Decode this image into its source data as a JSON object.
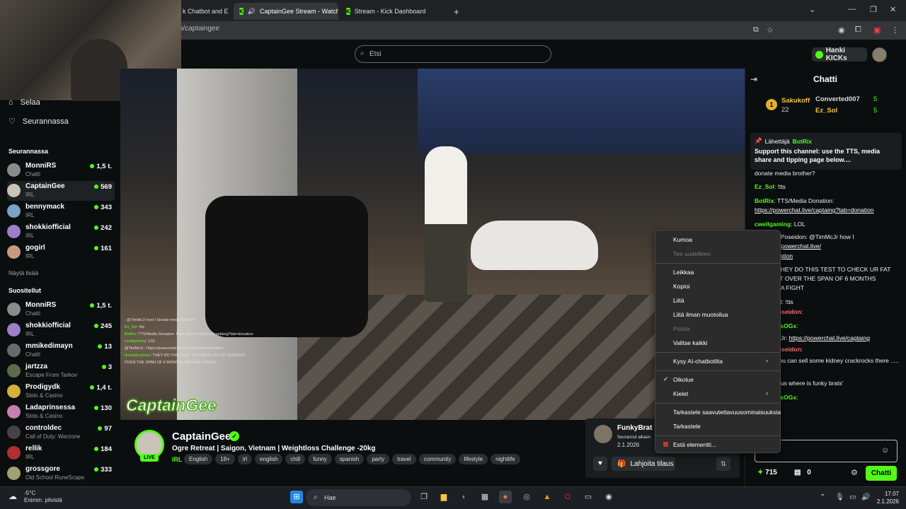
{
  "browser": {
    "tabs": [
      {
        "label": "k Chatbot and E",
        "active": false
      },
      {
        "label": "CaptainGee Stream - Watch",
        "active": true
      },
      {
        "label": "Stream - Kick Dashboard",
        "active": false
      }
    ],
    "new_tab": "+",
    "url": "m/captaingee"
  },
  "header": {
    "search_placeholder": "Etsi",
    "kicks_label": "Hanki KICKs"
  },
  "sidebar": {
    "browse_label": "Selaa",
    "following_nav_label": "Seurannassa",
    "following_heading": "Seurannassa",
    "following": [
      {
        "name": "MonniRS",
        "category": "Chatti",
        "viewers": "1,5 t.",
        "color": "#8b8b8b"
      },
      {
        "name": "CaptainGee",
        "category": "IRL",
        "viewers": "569",
        "color": "#c9c3b8"
      },
      {
        "name": "bennymack",
        "category": "IRL",
        "viewers": "343",
        "color": "#7aa2c7"
      },
      {
        "name": "shokkiofficial",
        "category": "IRL",
        "viewers": "242",
        "color": "#9b7fc7"
      },
      {
        "name": "gogirl",
        "category": "IRL",
        "viewers": "161",
        "color": "#c79a7f"
      }
    ],
    "show_more": "Näytä lisää",
    "recommended_heading": "Suositellut",
    "recommended": [
      {
        "name": "MonniRS",
        "category": "Chatti",
        "viewers": "1,5 t.",
        "color": "#8b8b8b"
      },
      {
        "name": "shokkiofficial",
        "category": "IRL",
        "viewers": "245",
        "color": "#9b7fc7"
      },
      {
        "name": "mmikedimayn",
        "category": "Chatti",
        "viewers": "13",
        "color": "#6a6a6a"
      },
      {
        "name": "jartzza",
        "category": "Escape From Tarkov",
        "viewers": "3",
        "color": "#5b6b4b"
      },
      {
        "name": "Prodigydk",
        "category": "Slots & Casino",
        "viewers": "1,4 t.",
        "color": "#d4b13a"
      },
      {
        "name": "Ladaprinsessa",
        "category": "Slots & Casino",
        "viewers": "130",
        "color": "#c77fb0"
      },
      {
        "name": "controldec",
        "category": "Call of Duty: Warzone",
        "viewers": "97",
        "color": "#444444"
      },
      {
        "name": "rellik",
        "category": "IRL",
        "viewers": "184",
        "color": "#b03030"
      },
      {
        "name": "grossgore",
        "category": "Old School RuneScape",
        "viewers": "333",
        "color": "#a0a070"
      }
    ]
  },
  "video": {
    "overlay_chat": [
      {
        "user": "",
        "text": ": @TimMcJr how I donate media brother?"
      },
      {
        "user": "Ez_Sol",
        "text": ": !tts"
      },
      {
        "user": "BotRix",
        "text": ": TTS/Media Donation: https://powerchat.live/captaing?tab=donation"
      },
      {
        "user": "cwellgaming",
        "text": ": LOL"
      },
      {
        "user": "",
        "text": "@TimMcJr : https://powerchat.live/captaing?tab=donation"
      },
      {
        "user": "donaldtrumsee",
        "text": ": THEY DO THIS TEST TO CHECK UR FAT PERCENT"
      },
      {
        "user": "",
        "text": "OVER THE SPAN OF 6 MONTHS BEFORE A FIGHT"
      }
    ],
    "watermark": "CaptainGee"
  },
  "stream_info": {
    "name": "CaptainGee",
    "live_badge": "LIVE",
    "title": "Ogre Retreat | Saigon, Vietnam | Weightloss Challenge -20kg",
    "category": "IRL",
    "tags": [
      "English",
      "18+",
      "irl",
      "english",
      "chill",
      "funny",
      "spanish",
      "party",
      "travel",
      "community",
      "lifestyle",
      "nightlife"
    ]
  },
  "follow_card": {
    "name": "FunkyBrat",
    "since_label": "Seurannut alkaen",
    "since_date": "2.1.2026",
    "gift_label": "Lahjoita tilaus"
  },
  "chat": {
    "title": "Chatti",
    "top_gifters": [
      {
        "name": "Sakukoff",
        "count": "22"
      },
      {
        "name": "Converted007",
        "count": "5"
      },
      {
        "name": "Ez_Sol",
        "count": "5"
      }
    ],
    "pinned": {
      "label": "Lähettäjä",
      "sender": "BotRix",
      "text": "Support this channel: use the TTS, media share and tipping page below...."
    },
    "messages": [
      {
        "user": "",
        "text": "donate media brother?"
      },
      {
        "user": "Ez_Sol",
        "text": ": !tts"
      },
      {
        "user": "BotRix",
        "text": ": TTS/Media Donation: ",
        "link": "https://powerchat.live/captaing?tab=donation"
      },
      {
        "user": "cwellgaming",
        "text": ": LOL"
      },
      {
        "user": "",
        "text": "an CryptoPoseidon: @TimMcJr how I d...",
        "link": "https://powerchat.live/"
      },
      {
        "user": "",
        "text": "",
        "link": "?tab=donation"
      },
      {
        "user": "umsee",
        "text": ": THEY DO THIS TEST TO CHECK UR FAT PERCENT OVER THE SPAN OF 6 MONTHS BEFORE A FIGHT"
      },
      {
        "user": "",
        "text": "an Ez_Sol: !tts"
      },
      {
        "user": "CryptoPoseidon",
        "text": ":"
      },
      {
        "user": "0G3NDrysOGx",
        "text": ":"
      },
      {
        "user": "",
        "text": "an TimMcJr: ",
        "link": "https://powerchat.live/captaing"
      },
      {
        "user": "CryptoPoseidon",
        "text": ":"
      },
      {
        "user": "onson",
        "text": ": you can sell some kidney crackrocks there ....."
      },
      {
        "user": "kukoff",
        "text": ": !sus where is funky brats'"
      },
      {
        "user": "0G3NDrysOGx",
        "text": ":"
      },
      {
        "user": "onson",
        "text": ":"
      }
    ],
    "points": "715",
    "points2": "0",
    "send_label": "Chatti"
  },
  "context_menu": {
    "items": [
      {
        "label": "Kumoa",
        "disabled": false
      },
      {
        "label": "Tee uudelleen",
        "disabled": true
      },
      {
        "label": "Leikkaa",
        "disabled": false
      },
      {
        "label": "Kopioi",
        "disabled": false
      },
      {
        "label": "Liitä",
        "disabled": false
      },
      {
        "label": "Liitä ilman muotoilua",
        "disabled": false
      },
      {
        "label": "Poista",
        "disabled": true
      },
      {
        "label": "Valitse kaikki",
        "disabled": false
      },
      {
        "label": "Kysy AI-chatbotilta",
        "disabled": false
      },
      {
        "label": "Oikolue",
        "disabled": false
      },
      {
        "label": "Kielet",
        "disabled": false
      },
      {
        "label": "Tarkastele saavutettavuusominaisuuksia",
        "disabled": false
      },
      {
        "label": "Tarkastele",
        "disabled": false
      },
      {
        "label": "Estä elementti...",
        "disabled": false
      }
    ]
  },
  "taskbar": {
    "temperature": "-5°C",
    "weather": "Enimm. pilvistä",
    "search": "Hae",
    "time": "17.07",
    "date": "2.1.2026"
  },
  "colors": {
    "accent": "#53fc18",
    "background": "#0b0e0f"
  }
}
